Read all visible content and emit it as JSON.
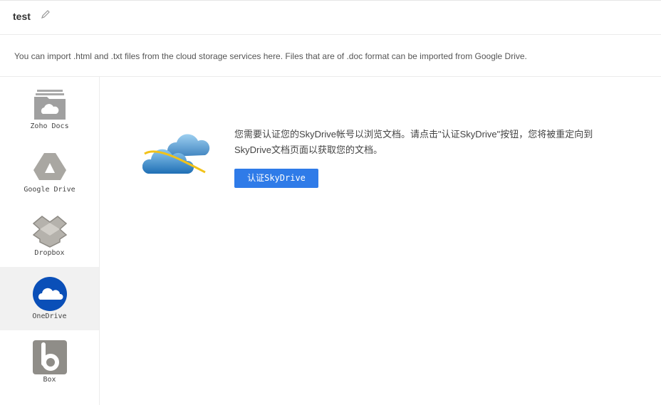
{
  "header": {
    "title": "test"
  },
  "info": "You can import .html and .txt files from the cloud storage services here. Files that are of .doc format can be imported from Google Drive.",
  "sidebar": {
    "items": [
      {
        "label": "Zoho Docs"
      },
      {
        "label": "Google Drive"
      },
      {
        "label": "Dropbox"
      },
      {
        "label": "OneDrive",
        "active": true
      },
      {
        "label": "Box"
      }
    ]
  },
  "main": {
    "message": "您需要认证您的SkyDrive帐号以浏览文档。请点击\"认证SkyDrive\"按钮，您将被重定向到SkyDrive文档页面以获取您的文档。",
    "button": "认证SkyDrive"
  },
  "colors": {
    "accent": "#2f7be8",
    "onedrive": "#0a4fb8"
  }
}
